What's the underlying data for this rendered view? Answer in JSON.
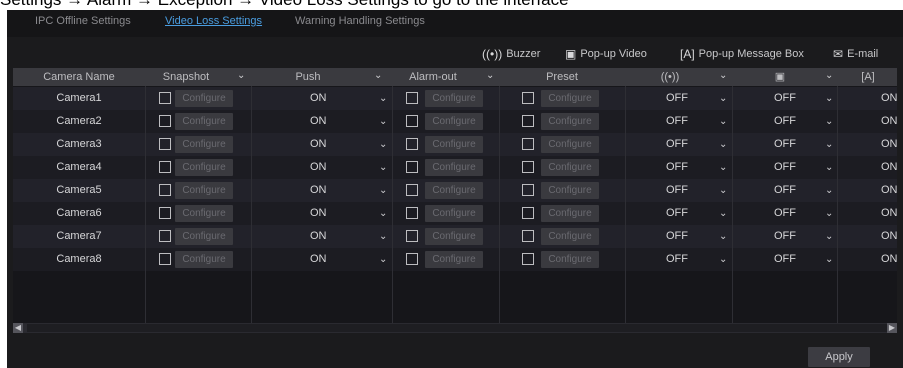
{
  "caption": "Settings → Alarm → Exception → Video Loss Settings to go to the interface",
  "tabs": [
    {
      "label": "IPC Offline Settings",
      "active": false
    },
    {
      "label": "Video Loss Settings",
      "active": true
    },
    {
      "label": "Warning Handling Settings",
      "active": false
    }
  ],
  "legend": [
    {
      "icon": "buzzer-icon",
      "glyph": "((•))",
      "label": "Buzzer"
    },
    {
      "icon": "popup-video-icon",
      "glyph": "▣",
      "label": "Pop-up Video"
    },
    {
      "icon": "popup-message-icon",
      "glyph": "[A]",
      "label": "Pop-up Message Box"
    },
    {
      "icon": "email-icon",
      "glyph": "✉",
      "label": "E-mail"
    }
  ],
  "columns": {
    "camera_name": "Camera Name",
    "snapshot": "Snapshot",
    "push": "Push",
    "alarm_out": "Alarm-out",
    "preset": "Preset",
    "buzzer_glyph": "((•))",
    "popup_video_glyph": "▣",
    "popup_message_glyph": "[A]"
  },
  "configure_label": "Configure",
  "rows": [
    {
      "camera": "Camera1",
      "push": "ON",
      "buzzer": "OFF",
      "popup_video": "OFF",
      "popup_message": "ON"
    },
    {
      "camera": "Camera2",
      "push": "ON",
      "buzzer": "OFF",
      "popup_video": "OFF",
      "popup_message": "ON"
    },
    {
      "camera": "Camera3",
      "push": "ON",
      "buzzer": "OFF",
      "popup_video": "OFF",
      "popup_message": "ON"
    },
    {
      "camera": "Camera4",
      "push": "ON",
      "buzzer": "OFF",
      "popup_video": "OFF",
      "popup_message": "ON"
    },
    {
      "camera": "Camera5",
      "push": "ON",
      "buzzer": "OFF",
      "popup_video": "OFF",
      "popup_message": "ON"
    },
    {
      "camera": "Camera6",
      "push": "ON",
      "buzzer": "OFF",
      "popup_video": "OFF",
      "popup_message": "ON"
    },
    {
      "camera": "Camera7",
      "push": "ON",
      "buzzer": "OFF",
      "popup_video": "OFF",
      "popup_message": "ON"
    },
    {
      "camera": "Camera8",
      "push": "ON",
      "buzzer": "OFF",
      "popup_video": "OFF",
      "popup_message": "ON"
    }
  ],
  "apply_label": "Apply",
  "colors": {
    "active_tab": "#4a9de0",
    "background": "#1b1b1d",
    "header": "#3a3a3f"
  }
}
